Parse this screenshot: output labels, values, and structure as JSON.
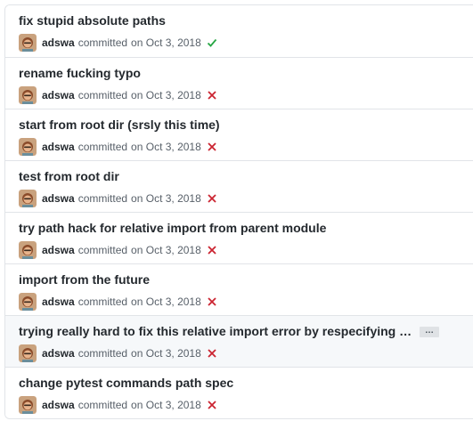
{
  "commits": [
    {
      "title": "fix stupid absolute paths",
      "author": "adswa",
      "verb": "committed",
      "date": "on Oct 3, 2018",
      "status": "success",
      "status_icon": "check-icon",
      "status_color": "#28a745"
    },
    {
      "title": "rename fucking typo",
      "author": "adswa",
      "verb": "committed",
      "date": "on Oct 3, 2018",
      "status": "failure",
      "status_icon": "x-icon",
      "status_color": "#cb2431"
    },
    {
      "title": "start from root dir (srsly this time)",
      "author": "adswa",
      "verb": "committed",
      "date": "on Oct 3, 2018",
      "status": "failure",
      "status_icon": "x-icon",
      "status_color": "#cb2431"
    },
    {
      "title": "test from root dir",
      "author": "adswa",
      "verb": "committed",
      "date": "on Oct 3, 2018",
      "status": "failure",
      "status_icon": "x-icon",
      "status_color": "#cb2431"
    },
    {
      "title": "try path hack for relative import from parent module",
      "author": "adswa",
      "verb": "committed",
      "date": "on Oct 3, 2018",
      "status": "failure",
      "status_icon": "x-icon",
      "status_color": "#cb2431"
    },
    {
      "title": "import from the future",
      "author": "adswa",
      "verb": "committed",
      "date": "on Oct 3, 2018",
      "status": "failure",
      "status_icon": "x-icon",
      "status_color": "#cb2431"
    },
    {
      "title": "trying really hard to fix this relative import error by respecifying …",
      "author": "adswa",
      "verb": "committed",
      "date": "on Oct 3, 2018",
      "status": "failure",
      "status_icon": "x-icon",
      "status_color": "#cb2431",
      "expand_label": "…"
    },
    {
      "title": "change pytest commands path spec",
      "author": "adswa",
      "verb": "committed",
      "date": "on Oct 3, 2018",
      "status": "failure",
      "status_icon": "x-icon",
      "status_color": "#cb2431"
    }
  ],
  "colors": {
    "title": "#24292e",
    "meta": "#586069",
    "border": "#e1e4e8",
    "highlight_row": "#f6f8fa",
    "avatar_bg": "#c9a27e",
    "avatar_face": "#e8b48c",
    "avatar_hair": "#8a4b2a"
  }
}
